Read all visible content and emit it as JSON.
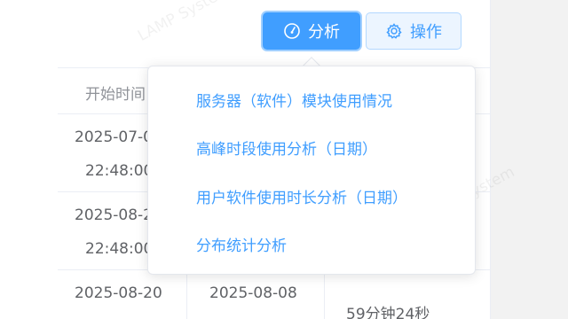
{
  "toolbar": {
    "analyze_label": "分析",
    "analyze_icon": "dashboard-gauge-icon",
    "operations_label": "操作",
    "operations_icon": "gear-icon"
  },
  "watermark": "LAMP System",
  "table": {
    "header_start_time": "开始时间",
    "rows": [
      {
        "start_date": "2025-07-0",
        "start_time": "22:48:00"
      },
      {
        "start_date": "2025-08-2",
        "start_time": "22:48:00"
      },
      {
        "start_date": "2025-08-20",
        "end_date": "2025-08-08",
        "duration": "59分钟24秒"
      }
    ]
  },
  "dropdown": {
    "items": [
      "服务器（软件）模块使用情况",
      "高峰时段使用分析（日期）",
      "用户软件使用时长分析（日期）",
      "分布统计分析"
    ]
  },
  "colors": {
    "primary": "#409eff",
    "primary_light": "#ecf5ff",
    "border": "#ebeef5",
    "text": "#606266"
  }
}
